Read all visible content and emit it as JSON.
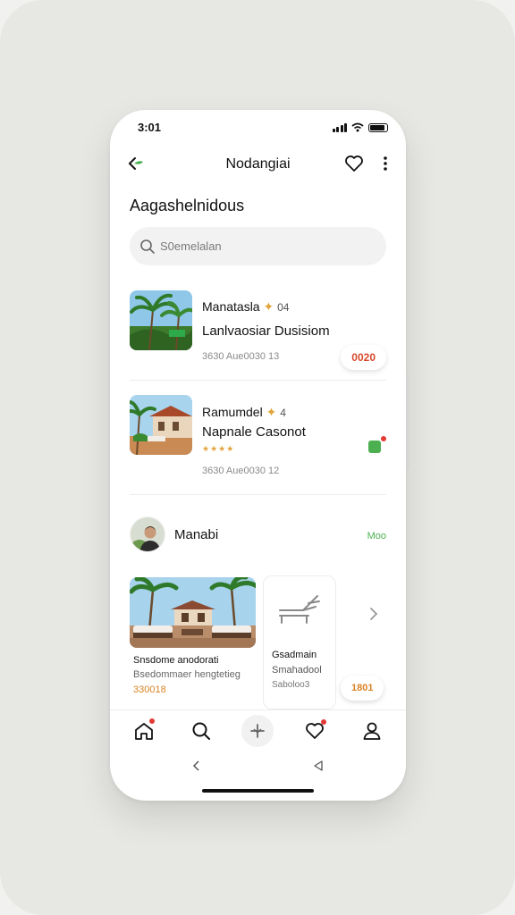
{
  "status_bar": {
    "time": "3:01"
  },
  "nav": {
    "title": "Nodangiai"
  },
  "section_heading": "Aagashelnidous",
  "search": {
    "placeholder": "S0emelalan"
  },
  "listings": [
    {
      "title": "Manatasla",
      "badge": "04",
      "subtitle": "Lanlvaosiar Dusisiom",
      "meta": "3630 Aue0030 13",
      "price": "0020",
      "price_color": "#d9482b"
    },
    {
      "title": "Ramumdel",
      "badge": "4",
      "subtitle": "Napnale Casonot",
      "stars": "★★★★",
      "meta": "3630 Aue0030 12"
    }
  ],
  "host": {
    "name": "Manabi",
    "more_label": "Moo"
  },
  "cards": [
    {
      "title": "Snsdome anodorati",
      "subtitle": "Bsedommaer hengtetieg",
      "price": "330018"
    },
    {
      "title": "Gsadmain",
      "subtitle": "Smahadool",
      "meta": "Saboloo3"
    }
  ],
  "book_chip": "1801",
  "tabs": [
    {
      "name": "home",
      "has_dot": true
    },
    {
      "name": "search"
    },
    {
      "name": "add"
    },
    {
      "name": "favorites",
      "has_dot": true
    },
    {
      "name": "profile"
    }
  ],
  "colors": {
    "accent_green": "#4caf50",
    "price_orange": "#d98324",
    "badge_red": "#e53935"
  }
}
